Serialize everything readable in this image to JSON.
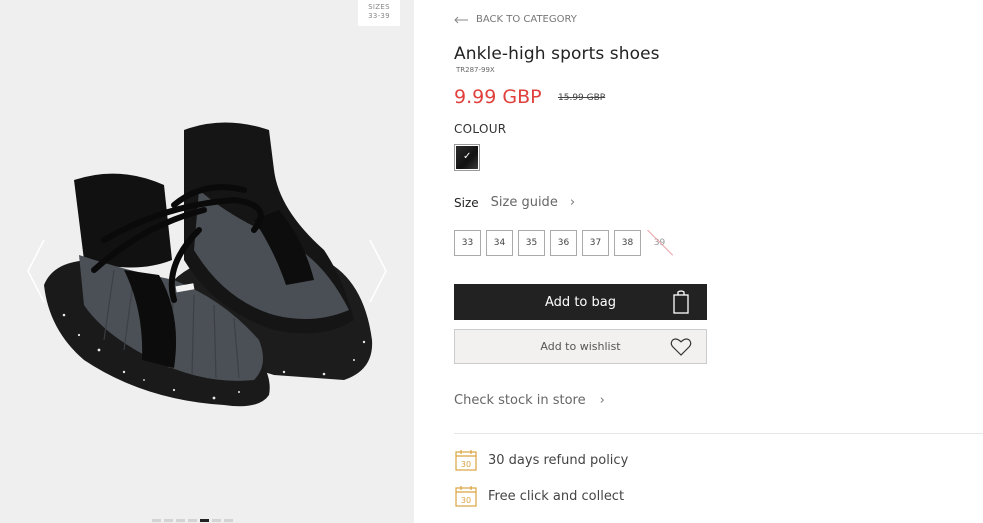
{
  "gallery": {
    "sizes_badge_line1": "SIZES",
    "sizes_badge_line2": "33-39",
    "image_alt": "Ankle-high sports shoes",
    "slide_count": 7,
    "active_slide": 4
  },
  "product": {
    "back_label": "BACK TO CATEGORY",
    "title": "Ankle-high sports shoes",
    "sku": "TR287-99X",
    "price": "9.99 GBP",
    "old_price": "15.99 GBP",
    "colour_label": "COLOUR",
    "size_label": "Size",
    "size_guide_label": "Size guide",
    "sizes": [
      {
        "label": "33",
        "available": true
      },
      {
        "label": "34",
        "available": true
      },
      {
        "label": "35",
        "available": true
      },
      {
        "label": "36",
        "available": true
      },
      {
        "label": "37",
        "available": true
      },
      {
        "label": "38",
        "available": true
      },
      {
        "label": "39",
        "available": false
      }
    ],
    "add_to_bag_label": "Add to bag",
    "add_to_wishlist_label": "Add to wishlist",
    "check_stock_label": "Check stock in store",
    "perks": [
      {
        "icon": "calendar-30-icon",
        "label": "30 days refund policy",
        "icon_text": "30"
      },
      {
        "icon": "calendar-30-icon",
        "label": "Free click and collect",
        "icon_text": "30"
      }
    ]
  },
  "colors": {
    "price_red": "#e0413d",
    "button_dark": "#222222",
    "perk_icon_gold": "#d9a441"
  }
}
